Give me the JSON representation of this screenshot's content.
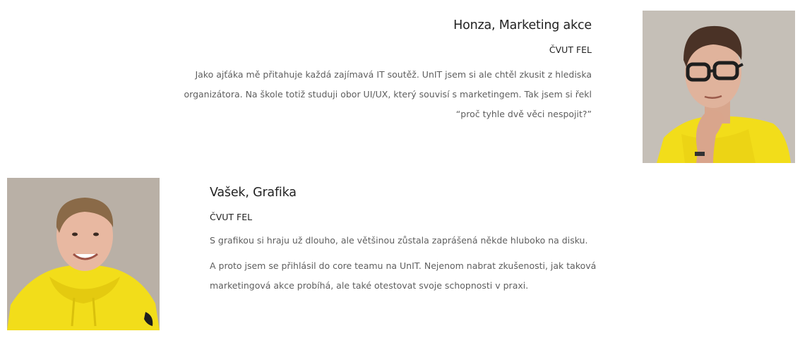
{
  "members": [
    {
      "name": "Honza, Marketing akce",
      "school": "ČVUT FEL",
      "paragraphs": [
        "Jako ajťáka mě přitahuje každá zajímavá IT soutěž. UnIT jsem si ale chtěl zkusit z hlediska organizátora. Na škole totiž studuji obor UI/UX, který souvisí s marketingem. Tak jsem si řekl “proč tyhle dvě věci nespojit?”"
      ],
      "photo_icon": "person-with-glasses-photo"
    },
    {
      "name": "Vašek, Grafika",
      "school": "ČVUT FEL",
      "paragraphs": [
        "S grafikou si hraju už dlouho, ale většinou zůstala zaprášená někde hluboko na disku.",
        "A proto jsem se přihlásil do core teamu na UnIT. Nejenom nabrat zkušenosti, jak taková marketingová akce probíhá, ale také otestovat svoje schopnosti v praxi."
      ],
      "photo_icon": "smiling-person-photo"
    }
  ],
  "colors": {
    "hoodie": "#f2dd1a",
    "background_wall": "#c9c4bd",
    "heading": "#222222",
    "body_text": "#5e5e5e"
  }
}
